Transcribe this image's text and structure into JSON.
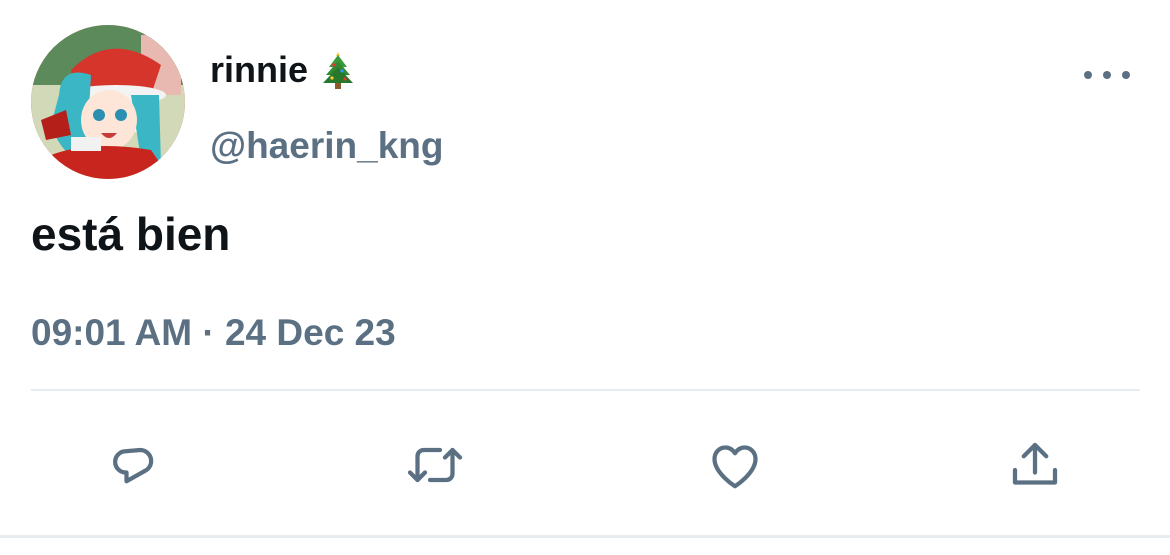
{
  "tweet": {
    "display_name": "rinnie",
    "display_name_emoji": "christmas-tree-icon",
    "handle": "@haerin_kng",
    "text": "está bien",
    "timestamp": "09:01 AM · 24 Dec 23"
  },
  "actions": [
    {
      "name": "reply",
      "icon": "reply-icon"
    },
    {
      "name": "retweet",
      "icon": "retweet-icon"
    },
    {
      "name": "like",
      "icon": "heart-icon"
    },
    {
      "name": "share",
      "icon": "share-icon"
    }
  ],
  "colors": {
    "primary_text": "#0f1419",
    "secondary_text": "#5b7083",
    "divider": "#e6ecf0",
    "background": "#ffffff"
  }
}
